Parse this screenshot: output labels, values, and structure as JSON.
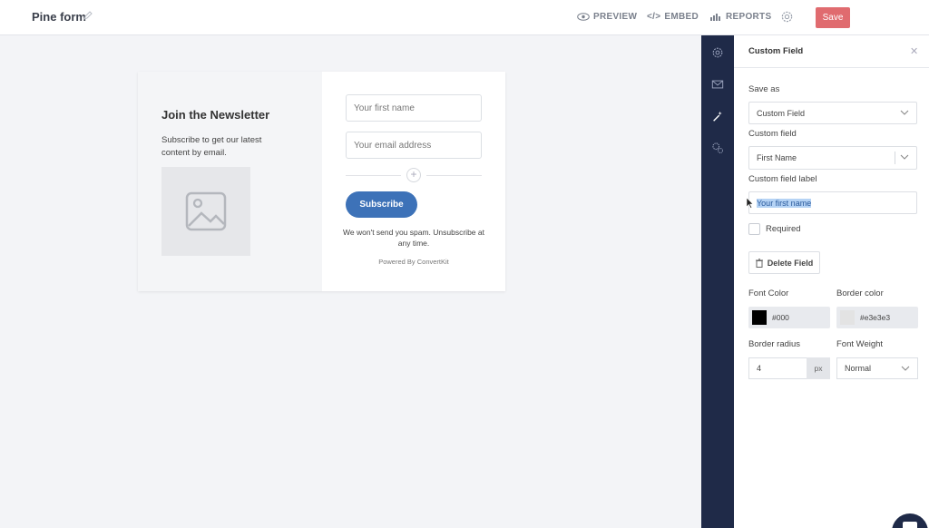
{
  "topbar": {
    "form_title": "Pine form",
    "preview_label": "PREVIEW",
    "embed_label": "EMBED",
    "reports_label": "REPORTS",
    "save_label": "Save"
  },
  "form_card": {
    "heading": "Join the Newsletter",
    "subheading": "Subscribe to get our latest content by email.",
    "first_name_placeholder": "Your first name",
    "email_placeholder": "Your email address",
    "subscribe_label": "Subscribe",
    "spam_note": "We won't send you spam. Unsubscribe at any time.",
    "powered_by": "Powered By ConvertKit"
  },
  "panel": {
    "title": "Custom Field",
    "save_as_label": "Save as",
    "save_as_value": "Custom Field",
    "custom_field_label": "Custom field",
    "custom_field_value": "First Name",
    "field_label_label": "Custom field label",
    "field_label_value": "Your first name",
    "required_label": "Required",
    "delete_label": "Delete Field",
    "font_color_label": "Font Color",
    "font_color_value": "#000",
    "border_color_label": "Border color",
    "border_color_value": "#e3e3e3",
    "border_radius_label": "Border radius",
    "border_radius_value": "4",
    "border_radius_unit": "px",
    "font_weight_label": "Font Weight",
    "font_weight_value": "Normal"
  },
  "colors": {
    "save_button": "#e06b6f",
    "subscribe_button": "#3d72b8",
    "rail": "#1f2a48",
    "selection": "#b5d3f5"
  },
  "icons": [
    "pencil-icon",
    "eye-icon",
    "code-icon",
    "bar-chart-icon",
    "gear-icon",
    "envelope-icon",
    "magic-wand-icon",
    "gears-icon",
    "image-icon",
    "plus-icon",
    "close-icon",
    "chevron-down-icon",
    "trash-icon",
    "chat-icon"
  ]
}
